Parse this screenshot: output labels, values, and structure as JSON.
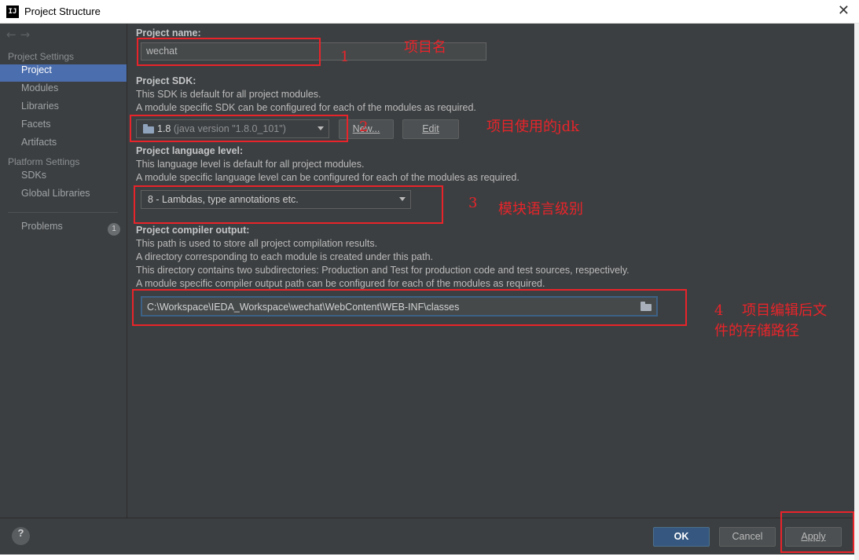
{
  "window": {
    "title": "Project Structure",
    "logo_text": "IJ"
  },
  "sidebar": {
    "project_settings_title": "Project Settings",
    "project_settings_items": [
      {
        "label": "Project"
      },
      {
        "label": "Modules"
      },
      {
        "label": "Libraries"
      },
      {
        "label": "Facets"
      },
      {
        "label": "Artifacts"
      }
    ],
    "platform_settings_title": "Platform Settings",
    "platform_settings_items": [
      {
        "label": "SDKs"
      },
      {
        "label": "Global Libraries"
      }
    ],
    "problems": {
      "label": "Problems",
      "count": "1"
    }
  },
  "project_name": {
    "label": "Project name:",
    "value": "wechat"
  },
  "project_sdk": {
    "label": "Project SDK:",
    "desc1": "This SDK is default for all project modules.",
    "desc2": "A module specific SDK can be configured for each of the modules as required.",
    "selected_name": "1.8",
    "selected_detail": "(java version \"1.8.0_101\")",
    "new_button": "New...",
    "edit_button": "Edit"
  },
  "language_level": {
    "label": "Project language level:",
    "desc1": "This language level is default for all project modules.",
    "desc2": "A module specific language level can be configured for each of the modules as required.",
    "selected": "8 - Lambdas, type annotations etc."
  },
  "compiler_output": {
    "label": "Project compiler output:",
    "desc1": "This path is used to store all project compilation results.",
    "desc2": "A directory corresponding to each module is created under this path.",
    "desc3": "This directory contains two subdirectories: Production and Test for production code and test sources, respectively.",
    "desc4": "A module specific compiler output path can be configured for each of the modules as required.",
    "path": "C:\\Workspace\\IEDA_Workspace\\wechat\\WebContent\\WEB-INF\\classes"
  },
  "footer": {
    "help": "?",
    "ok": "OK",
    "cancel": "Cancel",
    "apply": "Apply"
  },
  "annotations": {
    "a1_num": "1",
    "a1_text": "项目名",
    "a2_num": "2",
    "a2_text": "项目使用的jdk",
    "a3_num": "3",
    "a3_text": "模块语言级别",
    "a4_line1": "4　 项目编辑后文",
    "a4_line2": "件的存储路径"
  },
  "icons": {
    "back": "arrow-left-icon",
    "forward": "arrow-right-icon",
    "close": "close-icon",
    "sdk": "folder-icon",
    "browse": "folder-open-icon",
    "help": "help-icon"
  },
  "colors": {
    "accent": "#4b6eaf",
    "background": "#3c3f41",
    "annotation": "#e8242a",
    "ok_button": "#365880"
  }
}
